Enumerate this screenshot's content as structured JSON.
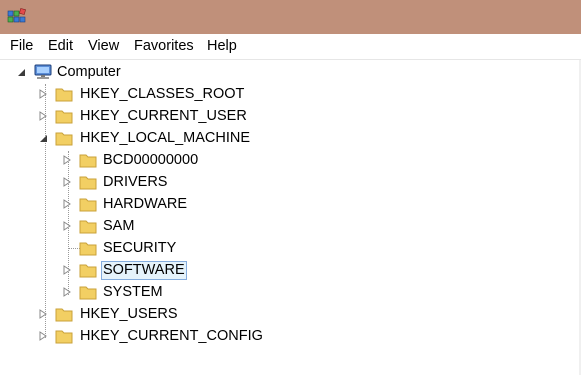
{
  "window": {
    "app_icon": "registry-editor-icon",
    "titlebar_color": "#c0907a"
  },
  "menu": {
    "items": [
      "File",
      "Edit",
      "View",
      "Favorites",
      "Help"
    ]
  },
  "tree": {
    "root": "Computer",
    "hives": [
      {
        "label": "HKEY_CLASSES_ROOT",
        "expanded": false
      },
      {
        "label": "HKEY_CURRENT_USER",
        "expanded": false
      },
      {
        "label": "HKEY_LOCAL_MACHINE",
        "expanded": true
      },
      {
        "label": "HKEY_USERS",
        "expanded": false
      },
      {
        "label": "HKEY_CURRENT_CONFIG",
        "expanded": false
      }
    ],
    "hklm_children": [
      {
        "label": "BCD00000000",
        "has_children": true
      },
      {
        "label": "DRIVERS",
        "has_children": true
      },
      {
        "label": "HARDWARE",
        "has_children": true
      },
      {
        "label": "SAM",
        "has_children": true
      },
      {
        "label": "SECURITY",
        "has_children": false
      },
      {
        "label": "SOFTWARE",
        "has_children": true,
        "selected": true
      },
      {
        "label": "SYSTEM",
        "has_children": true
      }
    ]
  },
  "colors": {
    "selection_fill": "#e5f3fb",
    "selection_border": "#84acdd",
    "folder": "#f2cf63"
  }
}
